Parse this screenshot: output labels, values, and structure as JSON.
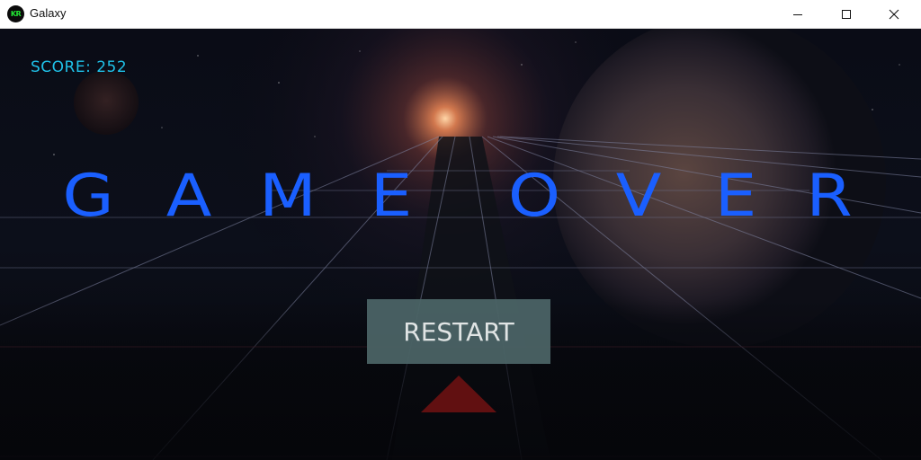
{
  "window": {
    "title": "Galaxy",
    "icon_text": "KR",
    "icon_color": "#22e634"
  },
  "controls": {
    "minimize": "minimize-icon",
    "maximize": "maximize-icon",
    "close": "close-icon"
  },
  "game": {
    "score_text": "SCORE: 252",
    "game_over_letters": [
      "G",
      "A",
      "M",
      "E",
      "O",
      "V",
      "E",
      "R"
    ],
    "restart_label": "RESTART",
    "colors": {
      "score": "#1fc1e8",
      "title": "#1a5fff",
      "button": "#4b6466",
      "ship": "#7a1212",
      "grid": "#6e7390"
    }
  }
}
